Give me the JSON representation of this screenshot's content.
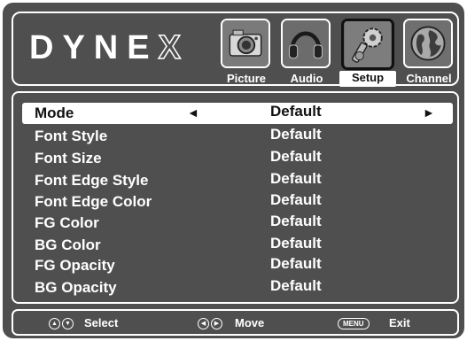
{
  "brand": {
    "logo_text": "DYNE",
    "logo_x": "X"
  },
  "tabs": [
    {
      "label": "Picture",
      "icon": "camera-icon",
      "selected": false
    },
    {
      "label": "Audio",
      "icon": "headphones-icon",
      "selected": false
    },
    {
      "label": "Setup",
      "icon": "tools-icon",
      "selected": true
    },
    {
      "label": "Channel",
      "icon": "globe-icon",
      "selected": false
    }
  ],
  "settings": [
    {
      "name": "Mode",
      "value": "Default",
      "selected": true
    },
    {
      "name": "Font Style",
      "value": "Default"
    },
    {
      "name": "Font Size",
      "value": "Default"
    },
    {
      "name": "Font Edge Style",
      "value": "Default"
    },
    {
      "name": "Font Edge Color",
      "value": "Default"
    },
    {
      "name": "FG Color",
      "value": "Default"
    },
    {
      "name": "BG Color",
      "value": "Default"
    },
    {
      "name": "FG Opacity",
      "value": "Default"
    },
    {
      "name": "BG Opacity",
      "value": "Default"
    }
  ],
  "selector_arrows": {
    "left": "◄",
    "right": "►"
  },
  "footer": {
    "select": {
      "key_up": "▲",
      "key_down": "▼",
      "label": "Select"
    },
    "move": {
      "key_left": "◀",
      "key_right": "▶",
      "label": "Move"
    },
    "exit": {
      "key": "MENU",
      "label": "Exit"
    }
  },
  "colors": {
    "background": "#4f4f4f",
    "text": "#ffffff",
    "highlight": "#ffffff",
    "highlight_text": "#111111"
  }
}
